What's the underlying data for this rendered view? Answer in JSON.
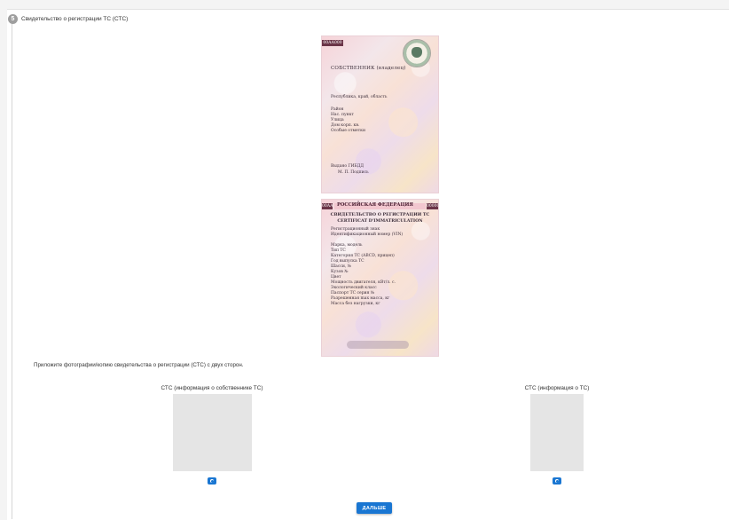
{
  "step": {
    "number": "5",
    "title": "Свидетельство о регистрации ТС (СТС)"
  },
  "sample_front": {
    "serial": "00АА000",
    "owner_heading": "СОБСТВЕННИК (владелец)",
    "lines": [
      "Республика, край, область",
      "Район",
      "Нас. пункт",
      "Улица",
      "Дом         корп.        кв.",
      "Особые отметки"
    ],
    "issued": "Выдано ГИБДД",
    "mp": "М. П.                   Подпись"
  },
  "sample_back": {
    "serial_left": "00АА",
    "federation": "РОССИЙСКАЯ ФЕДЕРАЦИЯ",
    "serial_right": "000000",
    "title_ru": "СВИДЕТЕЛЬСТВО О РЕГИСТРАЦИИ ТС",
    "title_fr": "CERTIFICAT D'IMMATRICULATION",
    "lines": [
      "Регистрационный знак",
      "Идентификационный номер (VIN)",
      "Марка, модель",
      "Тип ТС",
      "Категория ТС (ABCD, прицеп)",
      "Год выпуска ТС",
      "Шасси, №",
      "Кузов №",
      "Цвет",
      "Мощность двигателя, кВт/л. с.",
      "Экологический класс",
      "Паспорт ТС серия        №",
      "Разрешенная max масса, кг",
      "Масса без нагрузки, кг"
    ]
  },
  "instruction": "Приложите фотографии/копию свидетельства о регистрации (СТС) с двух сторон.",
  "uploads": [
    {
      "label": "СТС (информация о собственнике ТС)",
      "icon": "camera-icon"
    },
    {
      "label": "СТС (информация о ТС)",
      "icon": "camera-icon"
    }
  ],
  "next_button": "ДАЛЬШЕ",
  "colors": {
    "accent": "#1976d2",
    "badge": "#9e9e9e",
    "placeholder": "#e5e5e5"
  }
}
